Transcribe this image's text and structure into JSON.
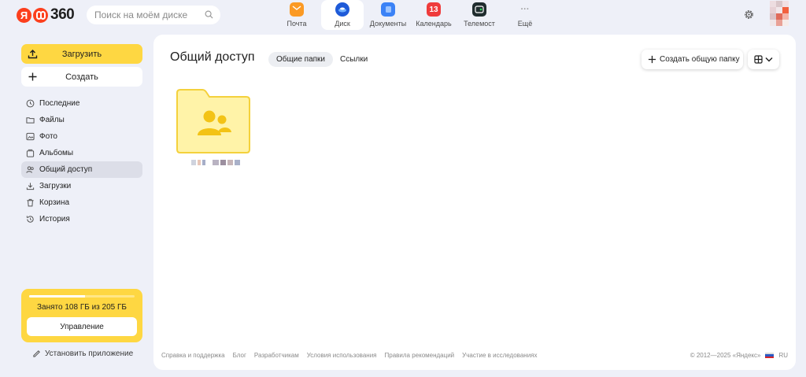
{
  "header": {
    "logo": {
      "ya": "Я",
      "num": "360"
    },
    "search_placeholder": "Поиск на моём диске",
    "services": [
      {
        "label": "Почта",
        "icon": "mail-icon",
        "color": "#fb9a24"
      },
      {
        "label": "Диск",
        "icon": "disk-icon",
        "color": "#1e5ad8",
        "active": true
      },
      {
        "label": "Документы",
        "icon": "documents-icon",
        "color": "#3b82f6"
      },
      {
        "label": "Календарь",
        "icon": "calendar-icon",
        "color": "#ef3b3b",
        "badge": "13"
      },
      {
        "label": "Телемост",
        "icon": "telemost-icon",
        "color": "#1f2c2e"
      },
      {
        "label": "Ещё",
        "icon": "more-icon",
        "glyph": "···"
      }
    ]
  },
  "sidebar": {
    "upload_label": "Загрузить",
    "create_label": "Создать",
    "items": [
      {
        "label": "Последние",
        "icon": "clock-icon"
      },
      {
        "label": "Файлы",
        "icon": "folder-icon"
      },
      {
        "label": "Фото",
        "icon": "photo-icon"
      },
      {
        "label": "Альбомы",
        "icon": "album-icon"
      },
      {
        "label": "Общий доступ",
        "icon": "shared-access-icon",
        "active": true
      },
      {
        "label": "Загрузки",
        "icon": "download-icon"
      },
      {
        "label": "Корзина",
        "icon": "trash-icon"
      },
      {
        "label": "История",
        "icon": "history-icon"
      }
    ],
    "storage": {
      "text": "Занято 108 ГБ из 205 ГБ",
      "used_fraction": 0.527,
      "manage_label": "Управление"
    },
    "install_label": "Установить приложение"
  },
  "main": {
    "title": "Общий доступ",
    "tabs": [
      {
        "label": "Общие папки",
        "active": true
      },
      {
        "label": "Ссылки"
      }
    ],
    "create_shared_label": "Создать общую папку",
    "folder": {
      "icon": "shared-folder-icon"
    }
  },
  "footer": {
    "links": [
      "Справка и поддержка",
      "Блог",
      "Разработчикам",
      "Условия использования",
      "Правила рекомендаций",
      "Участие в исследованиях"
    ],
    "copyright": "© 2012—2025 «Яндекс»",
    "lang": "RU"
  },
  "colors": {
    "accent": "#fed742",
    "folder": "#fff3a8",
    "folder_border": "#f4d13c",
    "folder_people": "#f3c316"
  }
}
